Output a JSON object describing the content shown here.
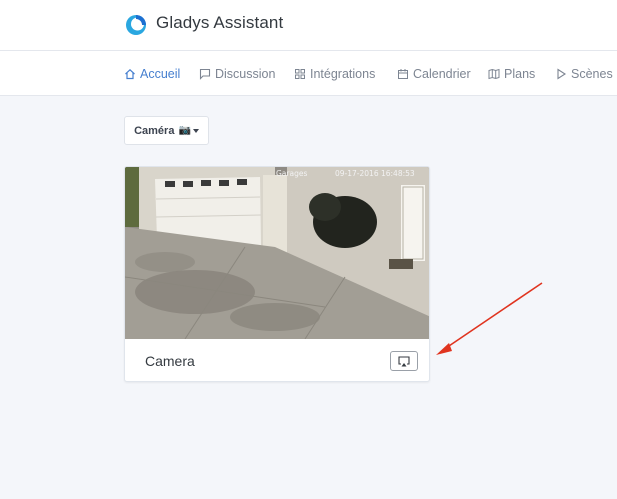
{
  "app": {
    "brand": "Gladys Assistant",
    "accent_color": "#467fcf"
  },
  "nav": {
    "items": [
      {
        "label": "Accueil",
        "icon": "home-icon",
        "active": true
      },
      {
        "label": "Discussion",
        "icon": "chat-icon",
        "active": false
      },
      {
        "label": "Intégrations",
        "icon": "grid-icon",
        "active": false
      },
      {
        "label": "Calendrier",
        "icon": "calendar-icon",
        "active": false
      },
      {
        "label": "Plans",
        "icon": "map-icon",
        "active": false
      },
      {
        "label": "Scènes",
        "icon": "play-icon",
        "active": false
      }
    ]
  },
  "camera_selector": {
    "label": "Caméra",
    "emoji": "📷"
  },
  "camera_card": {
    "title": "Camera",
    "overlay_location": "Garages",
    "overlay_timestamp": "09-17-2016 16:48:53",
    "action_icon": "airplay-icon"
  },
  "annotation": {
    "arrow_color": "#e0341f"
  }
}
